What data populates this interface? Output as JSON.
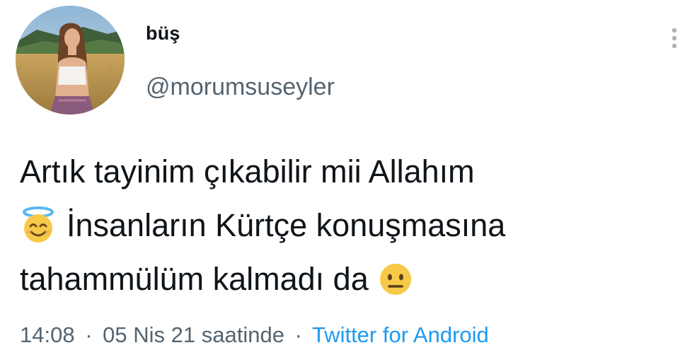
{
  "author": {
    "display_name": "büş",
    "handle": "@morumsuseyler"
  },
  "tweet": {
    "line1": "Artık tayinim çıkabilir mii Allahım",
    "line2_emoji": "smiling-face-with-halo",
    "line2": "İnsanların Kürtçe konuşmasına",
    "line3": "tahammülüm kalmadı da",
    "line3_emoji": "neutral-face"
  },
  "meta": {
    "time": "14:08",
    "separator": "·",
    "date_text": "05 Nis 21 saatinde",
    "source": "Twitter for Android"
  },
  "icons": {
    "more": "more-vertical-icon"
  },
  "colors": {
    "text": "#0f1419",
    "secondary": "#536471",
    "link": "#1d9bf0"
  }
}
